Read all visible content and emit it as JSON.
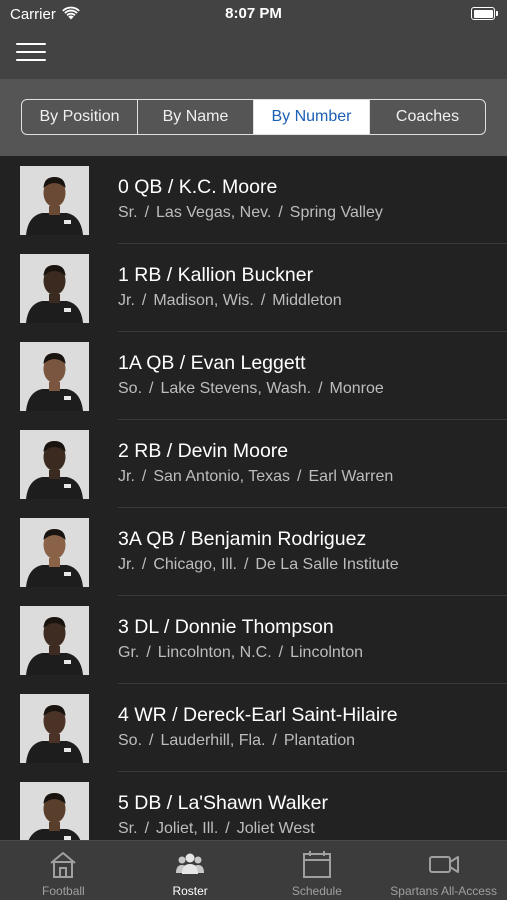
{
  "status": {
    "carrier": "Carrier",
    "time": "8:07 PM"
  },
  "segments": [
    {
      "label": "By Position",
      "active": false
    },
    {
      "label": "By Name",
      "active": false
    },
    {
      "label": "By Number",
      "active": true
    },
    {
      "label": "Coaches",
      "active": false
    }
  ],
  "players": [
    {
      "title": "0 QB / K.C. Moore",
      "year": "Sr.",
      "hometown": "Las Vegas, Nev.",
      "school": "Spring Valley"
    },
    {
      "title": "1 RB / Kallion Buckner",
      "year": "Jr.",
      "hometown": "Madison, Wis.",
      "school": "Middleton"
    },
    {
      "title": "1A QB / Evan Leggett",
      "year": "So.",
      "hometown": "Lake Stevens, Wash.",
      "school": "Monroe"
    },
    {
      "title": "2 RB / Devin Moore",
      "year": "Jr.",
      "hometown": "San Antonio, Texas",
      "school": "Earl Warren"
    },
    {
      "title": "3A QB / Benjamin Rodriguez",
      "year": "Jr.",
      "hometown": "Chicago, Ill.",
      "school": "De La Salle Institute"
    },
    {
      "title": "3 DL / Donnie Thompson",
      "year": "Gr.",
      "hometown": "Lincolnton, N.C.",
      "school": "Lincolnton"
    },
    {
      "title": "4 WR / Dereck-Earl Saint-Hilaire",
      "year": "So.",
      "hometown": "Lauderhill, Fla.",
      "school": "Plantation"
    },
    {
      "title": "5 DB / La'Shawn Walker",
      "year": "Sr.",
      "hometown": "Joliet, Ill.",
      "school": "Joliet West"
    }
  ],
  "tabs": [
    {
      "label": "Football",
      "icon": "house-icon",
      "active": false
    },
    {
      "label": "Roster",
      "icon": "people-icon",
      "active": true
    },
    {
      "label": "Schedule",
      "icon": "calendar-icon",
      "active": false
    },
    {
      "label": "Spartans All-Access",
      "icon": "video-camera-icon",
      "active": false
    }
  ],
  "colors": {
    "accent": "#1c5fb5",
    "list_bg": "#222222",
    "header_bg": "#434343",
    "segment_bg": "#555555"
  }
}
